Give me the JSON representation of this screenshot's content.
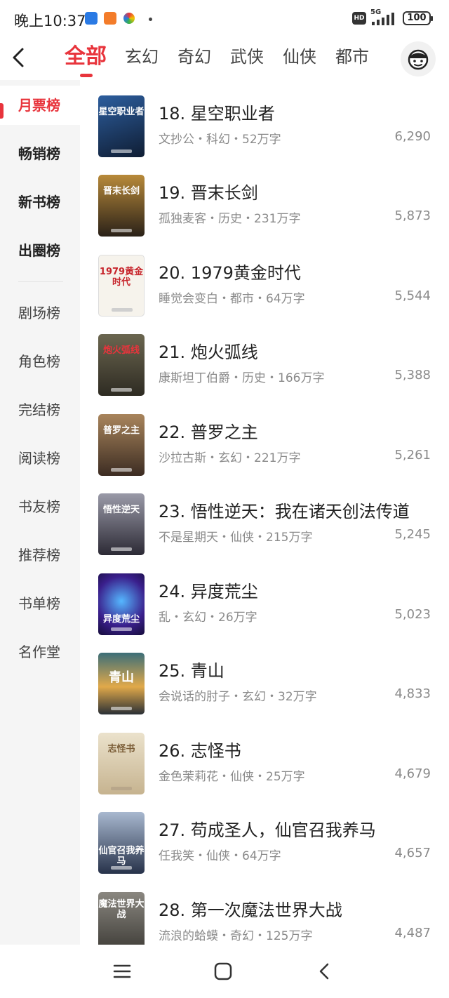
{
  "status_bar": {
    "time": "晚上10:37",
    "hd": "HD",
    "network": "5G",
    "battery": "100"
  },
  "tabs": [
    {
      "label": "全部",
      "active": true
    },
    {
      "label": "玄幻"
    },
    {
      "label": "奇幻"
    },
    {
      "label": "武侠"
    },
    {
      "label": "仙侠"
    },
    {
      "label": "都市"
    }
  ],
  "sidebar": {
    "items": [
      {
        "label": "月票榜",
        "active": true
      },
      {
        "label": "畅销榜",
        "bold": true
      },
      {
        "label": "新书榜",
        "bold": true
      },
      {
        "label": "出圈榜",
        "bold": true
      },
      {
        "label": "剧场榜"
      },
      {
        "label": "角色榜"
      },
      {
        "label": "完结榜"
      },
      {
        "label": "阅读榜"
      },
      {
        "label": "书友榜"
      },
      {
        "label": "推荐榜"
      },
      {
        "label": "书单榜"
      },
      {
        "label": "名作堂"
      }
    ]
  },
  "books": [
    {
      "title": "18. 星空职业者",
      "meta": "文抄公・科幻・52万字",
      "score": "6,290",
      "cover_text": "星空职业者",
      "cover_color": "#1f3e6e"
    },
    {
      "title": "19. 晋末长剑",
      "meta": "孤独麦客・历史・231万字",
      "score": "5,873",
      "cover_text": "晋末长剑",
      "cover_color": "#5a4423"
    },
    {
      "title": "20. 1979黄金时代",
      "meta": "睡觉会变白・都市・64万字",
      "score": "5,544",
      "cover_text": "1979黄金时代",
      "cover_color": "#f4f1ea"
    },
    {
      "title": "21. 炮火弧线",
      "meta": "康斯坦丁伯爵・历史・166万字",
      "score": "5,388",
      "cover_text": "炮火弧线",
      "cover_color": "#4e4a3d"
    },
    {
      "title": "22. 普罗之主",
      "meta": "沙拉古斯・玄幻・221万字",
      "score": "5,261",
      "cover_text": "普罗之主",
      "cover_color": "#7a5f45"
    },
    {
      "title": "23. 悟性逆天：我在诸天创法传道",
      "meta": "不是星期天・仙侠・215万字",
      "score": "5,245",
      "cover_text": "悟性逆天",
      "cover_color": "#4d5060"
    },
    {
      "title": "24. 异度荒尘",
      "meta": "乱・玄幻・26万字",
      "score": "5,023",
      "cover_text": "异度荒尘",
      "cover_color": "#3a2f8f"
    },
    {
      "title": "25. 青山",
      "meta": "会说话的肘子・玄幻・32万字",
      "score": "4,833",
      "cover_text": "青山",
      "cover_color": "#2b4a52"
    },
    {
      "title": "26. 志怪书",
      "meta": "金色茉莉花・仙侠・25万字",
      "score": "4,679",
      "cover_text": "志怪书",
      "cover_color": "#d8c9a8"
    },
    {
      "title": "27. 苟成圣人，仙官召我养马",
      "meta": "任我笑・仙侠・64万字",
      "score": "4,657",
      "cover_text": "仙官召我养马",
      "cover_color": "#3f4f6a"
    },
    {
      "title": "28. 第一次魔法世界大战",
      "meta": "流浪的蛤蟆・奇幻・125万字",
      "score": "4,487",
      "cover_text": "魔法世界大战",
      "cover_color": "#5c5a55"
    }
  ],
  "colors": {
    "accent": "#e8343c",
    "sidebar_bg": "#f5f5f5",
    "meta_text": "#8a8a8a"
  },
  "icons": {
    "back": "chevron-left-icon",
    "avatar": "user-avatar-icon",
    "nav_menu": "menu-icon",
    "nav_home": "square-home-icon",
    "nav_back": "back-triangle-icon"
  }
}
